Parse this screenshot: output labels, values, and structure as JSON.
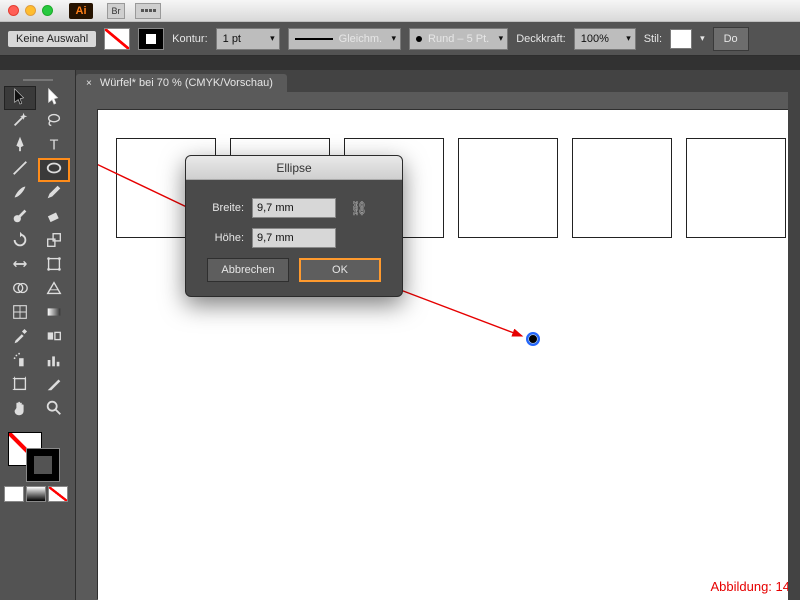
{
  "titlebar": {
    "app_badge": "Ai",
    "btn_br": "Br"
  },
  "controlbar": {
    "selection_label": "Keine Auswahl",
    "kontur_label": "Kontur:",
    "weight": "1 pt",
    "dash_label": "Gleichm.",
    "profile_label": "Rund – 5 Pt.",
    "deckkraft_label": "Deckkraft:",
    "opacity": "100%",
    "stil_label": "Stil:",
    "do_label": "Do"
  },
  "tab": {
    "close": "×",
    "label": "Würfel* bei 70 % (CMYK/Vorschau)"
  },
  "dialog": {
    "title": "Ellipse",
    "width_label": "Breite:",
    "width_value": "9,7 mm",
    "height_label": "Höhe:",
    "height_value": "9,7 mm",
    "cancel": "Abbrechen",
    "ok": "OK"
  },
  "caption": "Abbildung: 14",
  "tools": {
    "rows": [
      [
        "selection",
        "direct-selection"
      ],
      [
        "magic-wand",
        "lasso"
      ],
      [
        "pen",
        "type"
      ],
      [
        "line",
        "ellipse"
      ],
      [
        "brush",
        "pencil"
      ],
      [
        "blob-brush",
        "eraser"
      ],
      [
        "rotate",
        "scale"
      ],
      [
        "width",
        "free-transform"
      ],
      [
        "shape-builder",
        "perspective"
      ],
      [
        "mesh",
        "gradient"
      ],
      [
        "eyedropper",
        "blend"
      ],
      [
        "symbol-spray",
        "column-graph"
      ],
      [
        "artboard",
        "slice"
      ],
      [
        "hand",
        "zoom"
      ]
    ]
  }
}
